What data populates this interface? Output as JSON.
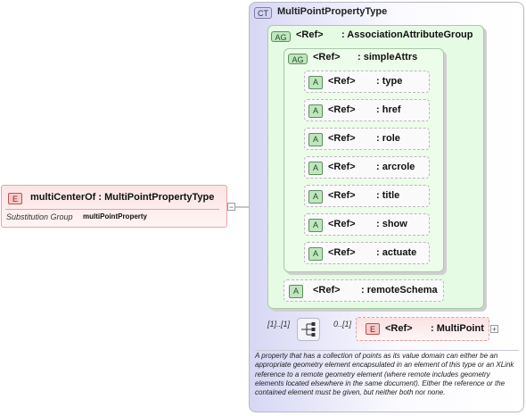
{
  "complex_type": {
    "badge": "CT",
    "name": "MultiPointPropertyType"
  },
  "attribute_group_outer": {
    "badge": "AG",
    "ref": "<Ref>",
    "name": ": AssociationAttributeGroup"
  },
  "attribute_group_inner": {
    "badge": "AG",
    "ref": "<Ref>",
    "name": ": simpleAttrs"
  },
  "simple_attrs": [
    {
      "badge": "A",
      "ref": "<Ref>",
      "name": ": type"
    },
    {
      "badge": "A",
      "ref": "<Ref>",
      "name": ": href"
    },
    {
      "badge": "A",
      "ref": "<Ref>",
      "name": ": role"
    },
    {
      "badge": "A",
      "ref": "<Ref>",
      "name": ": arcrole"
    },
    {
      "badge": "A",
      "ref": "<Ref>",
      "name": ": title"
    },
    {
      "badge": "A",
      "ref": "<Ref>",
      "name": ": show"
    },
    {
      "badge": "A",
      "ref": "<Ref>",
      "name": ": actuate"
    }
  ],
  "remote_schema": {
    "badge": "A",
    "ref": "<Ref>",
    "name": ": remoteSchema"
  },
  "element": {
    "badge": "E",
    "name": "multiCenterOf : MultiPointPropertyType",
    "expand": "−",
    "substitution_label": "Substitution Group",
    "substitution_value": "multiPointProperty"
  },
  "sequence": {
    "occurrence": "[1]..[1]"
  },
  "multipoint": {
    "badge": "E",
    "ref": "<Ref>",
    "name": ": MultiPoint",
    "occurrence": "0..[1]",
    "expand": "+"
  },
  "description": "A property that has a collection of points as its value domain can either be an appropriate geometry element encapsulated in an element of this type or an XLink reference to a remote geometry element (where remote includes geometry elements located elsewhere in the same document). Either the reference or the contained element must be given, but neither both nor none."
}
